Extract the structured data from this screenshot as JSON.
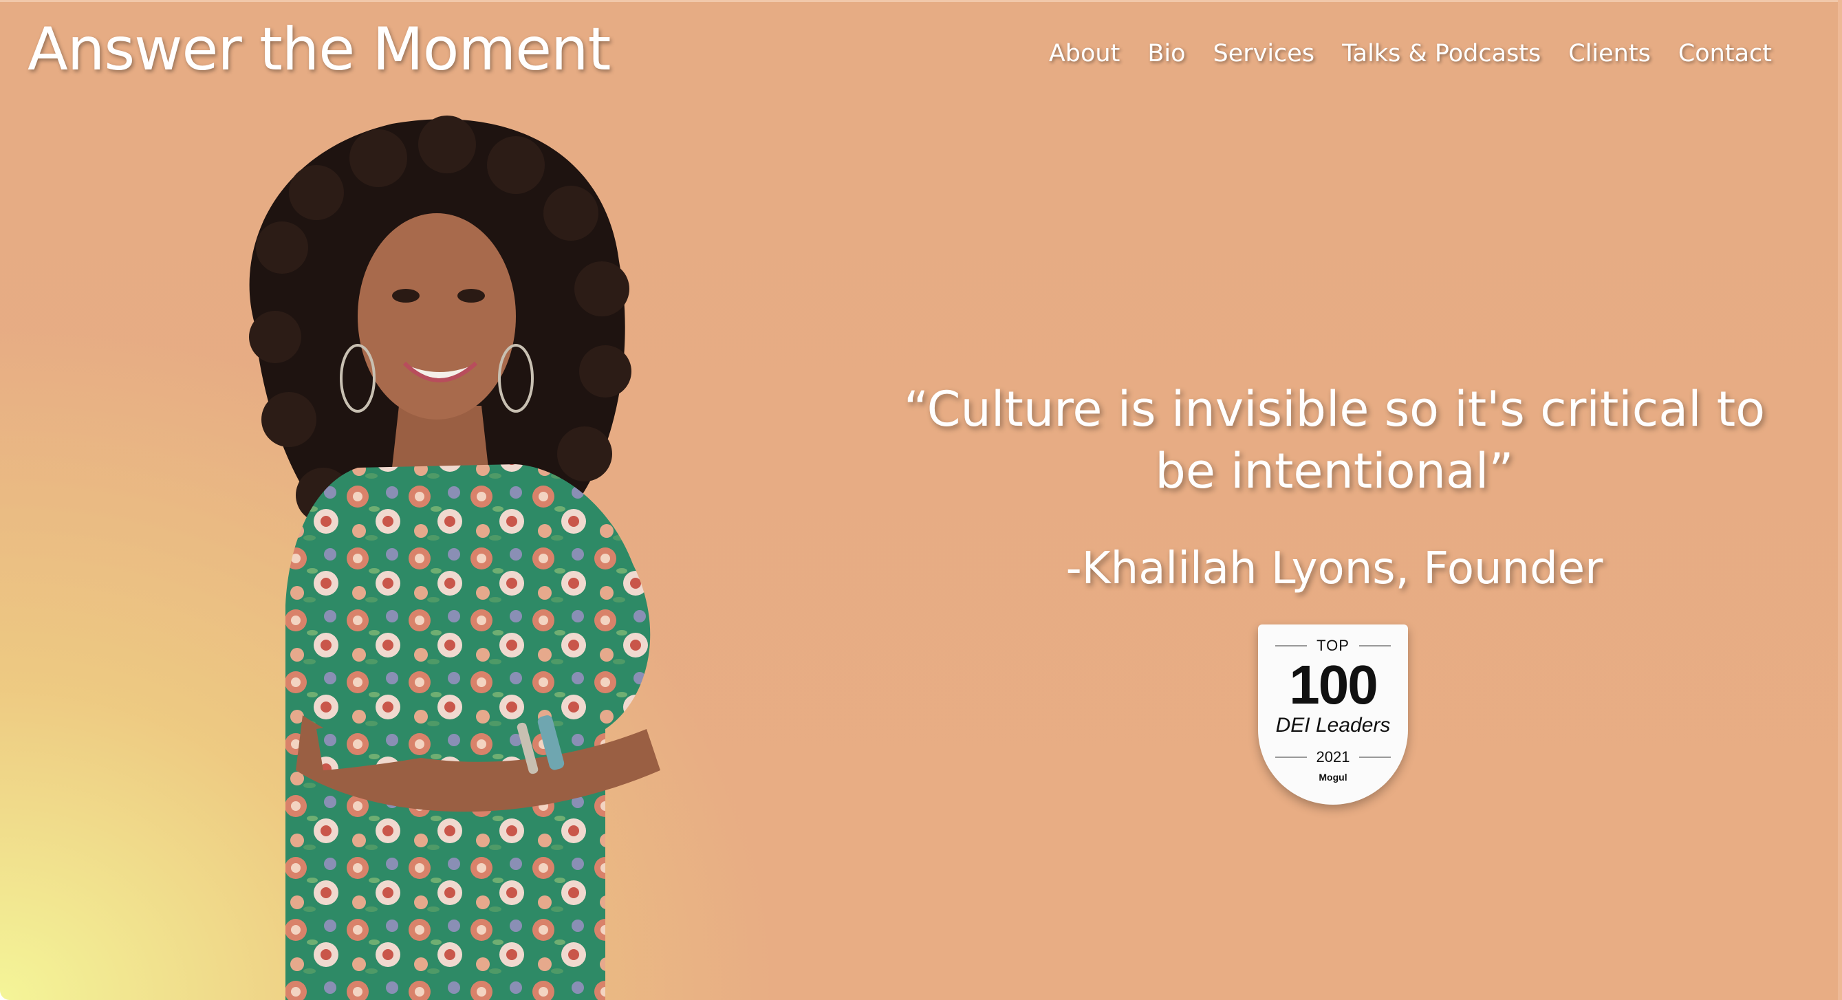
{
  "header": {
    "brand": "Answer the Moment",
    "nav": [
      "About",
      "Bio",
      "Services",
      "Talks & Podcasts",
      "Clients",
      "Contact"
    ]
  },
  "hero": {
    "quote": "“Culture is invisible so it's critical to be intentional”",
    "attribution": "-Khalilah Lyons, Founder"
  },
  "badge": {
    "top": "TOP",
    "number": "100",
    "label": "DEI Leaders",
    "year": "2021",
    "brand": "Mogul"
  },
  "colors": {
    "background": "#e8ad84",
    "gradient_corner": "#f4f598",
    "text": "#ffffff",
    "dress": "#2e8a66"
  },
  "image": {
    "portrait_alt": "Portrait of woman with curly hair in floral dress, arms crossed"
  }
}
